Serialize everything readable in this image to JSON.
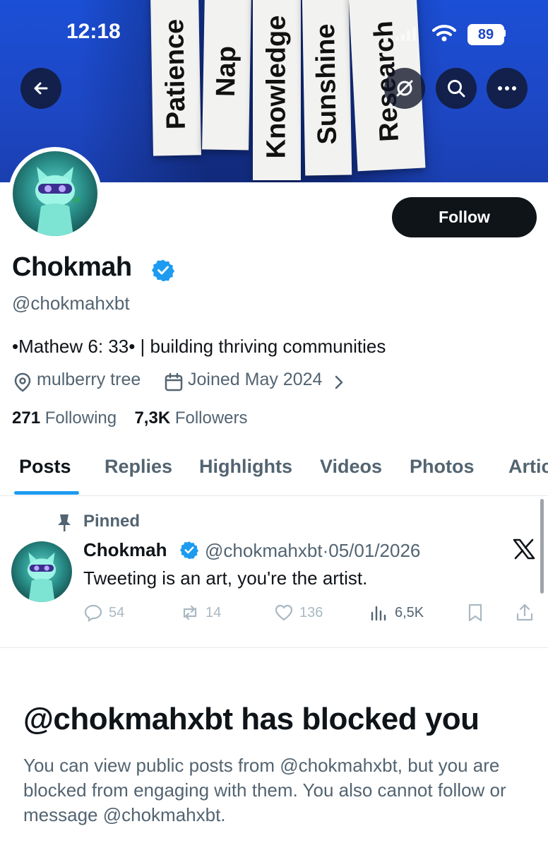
{
  "status_bar": {
    "time": "12:18",
    "battery": "89"
  },
  "banner": {
    "words": [
      "Patience",
      "Nap",
      "Knowledge",
      "Sunshine",
      "Research"
    ]
  },
  "profile": {
    "follow_label": "Follow",
    "name": "Chokmah",
    "handle": "@chokmahxbt",
    "bio": "•Mathew 6: 33• | building thriving communities",
    "location": "mulberry tree",
    "joined": "Joined May 2024",
    "following_count": "271",
    "following_label": "Following",
    "followers_count": "7,3K",
    "followers_label": "Followers"
  },
  "tabs": [
    {
      "label": "Posts",
      "active": true
    },
    {
      "label": "Replies"
    },
    {
      "label": "Highlights"
    },
    {
      "label": "Videos"
    },
    {
      "label": "Photos"
    },
    {
      "label": "Artic"
    }
  ],
  "pinned_post": {
    "pinned_label": "Pinned",
    "name": "Chokmah",
    "handle": "@chokmahxbt",
    "date": "05/01/2026",
    "separator": "·",
    "text": "Tweeting is an art, you're the artist.",
    "replies": "54",
    "reposts": "14",
    "likes": "136",
    "views": "6,5K"
  },
  "blocked": {
    "title": "@chokmahxbt has blocked you",
    "description": "You can view public posts from @chokmahxbt, but you are blocked from engaging with them. You also cannot follow or message @chokmahxbt."
  },
  "colors": {
    "accent": "#1d9bf0",
    "text": "#0f1419",
    "muted": "#536471",
    "banner": "#1d47c4"
  }
}
